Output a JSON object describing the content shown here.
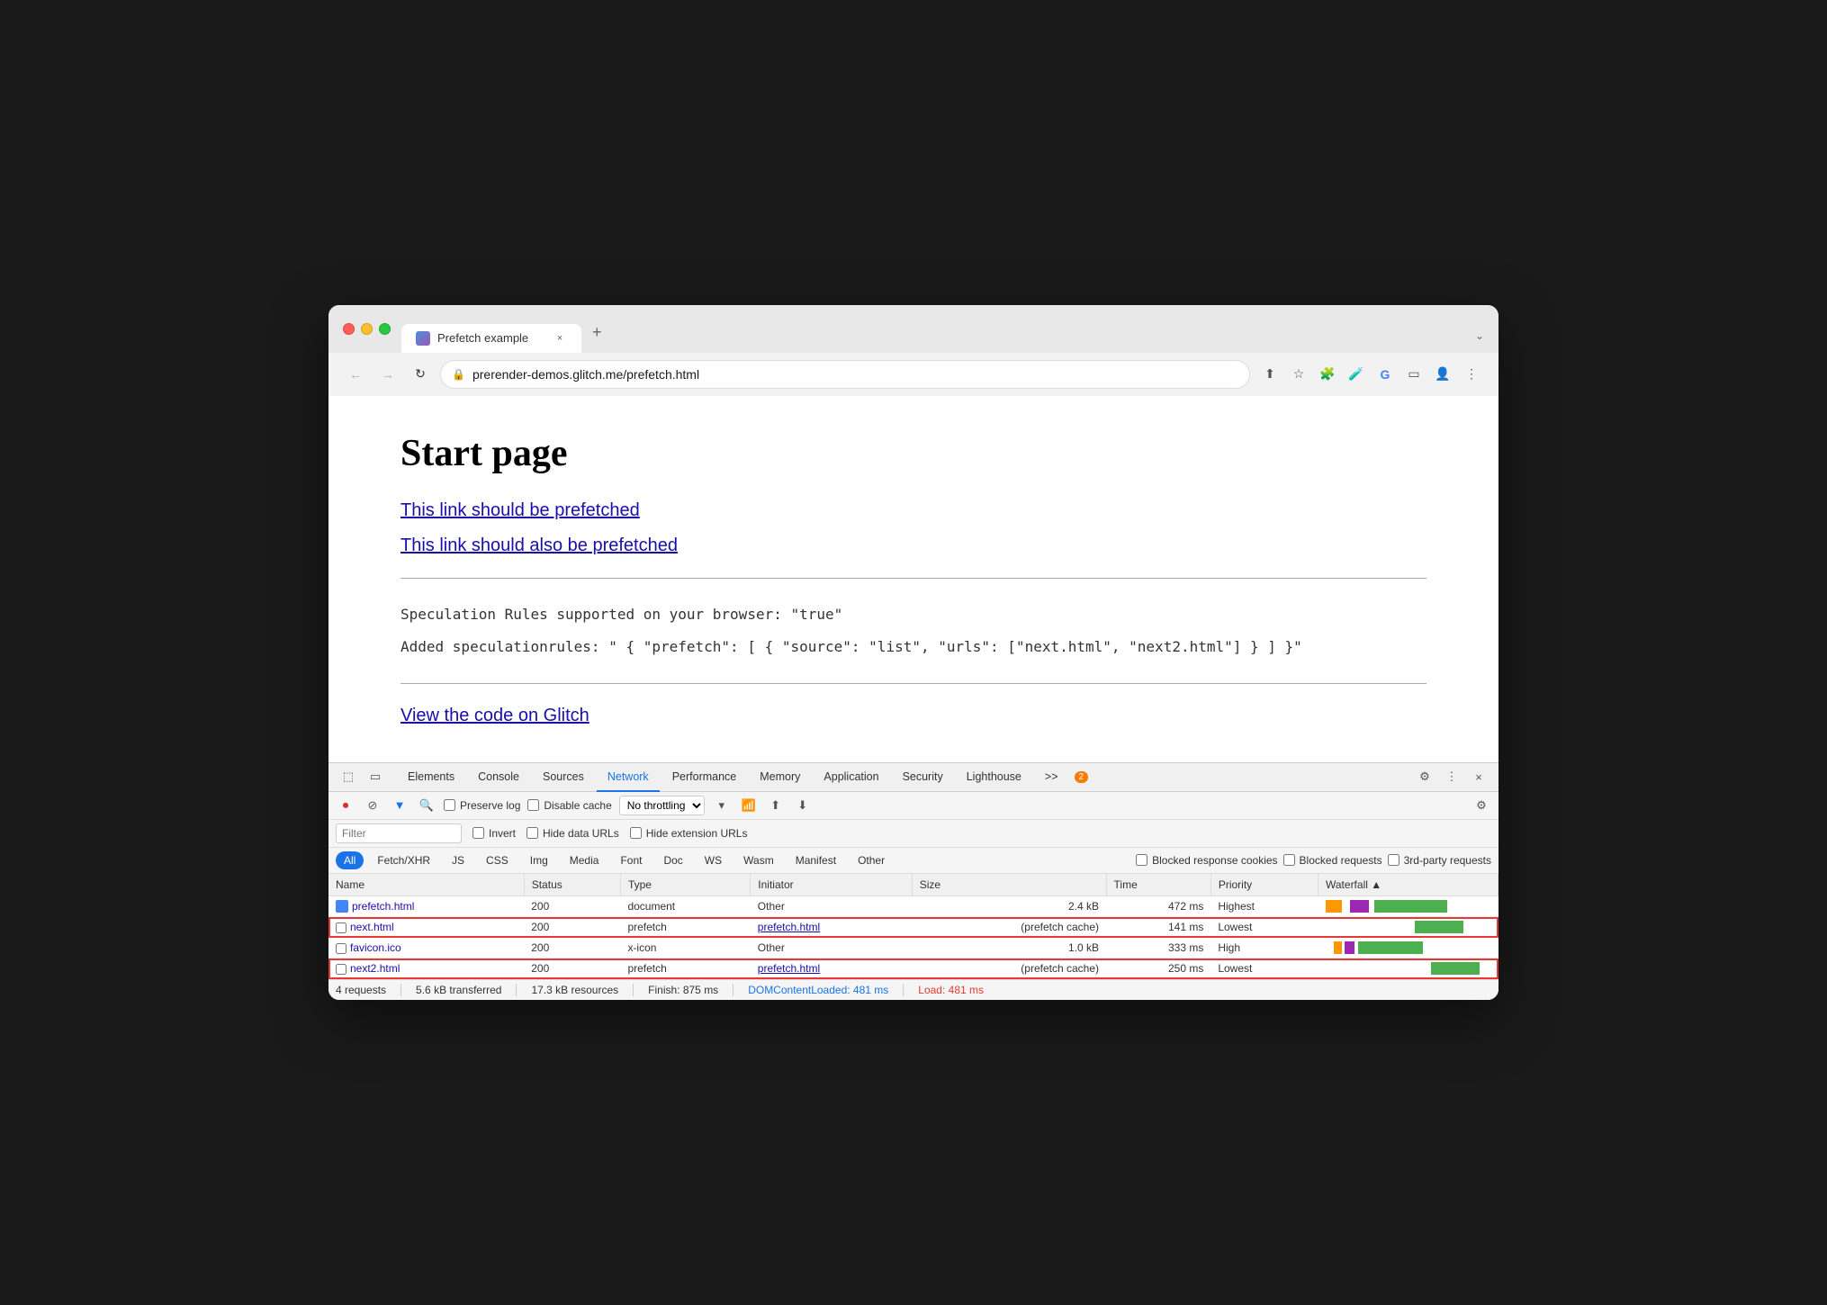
{
  "browser": {
    "tab_title": "Prefetch example",
    "tab_close": "×",
    "tab_new": "+",
    "tab_chevron": "⌄",
    "url": "prerender-demos.glitch.me/prefetch.html",
    "nav_back": "←",
    "nav_forward": "→",
    "nav_reload": "↻"
  },
  "page": {
    "title": "Start page",
    "link1": "This link should be prefetched",
    "link2": "This link should also be prefetched",
    "speculation1": "Speculation Rules supported on your browser: \"true\"",
    "speculation2": "Added speculationrules: \" { \"prefetch\": [ { \"source\": \"list\", \"urls\": [\"next.html\", \"next2.html\"] } ] }\"",
    "glitch_link": "View the code on Glitch"
  },
  "devtools": {
    "tabs": [
      "Elements",
      "Console",
      "Sources",
      "Network",
      "Performance",
      "Memory",
      "Application",
      "Security",
      "Lighthouse"
    ],
    "active_tab": "Network",
    "more_tabs": ">>",
    "badge_count": "2",
    "settings_icon": "⚙",
    "more_icon": "⋮",
    "close_icon": "×"
  },
  "network_toolbar": {
    "record": "●",
    "clear": "⊘",
    "filter": "▼",
    "search": "🔍",
    "preserve_log": "Preserve log",
    "disable_cache": "Disable cache",
    "throttle": "No throttling",
    "upload": "↑",
    "download": "↓",
    "settings": "⚙"
  },
  "filter_row": {
    "placeholder": "Filter",
    "invert": "Invert",
    "hide_data_urls": "Hide data URLs",
    "hide_extension_urls": "Hide extension URLs"
  },
  "type_filters": [
    "All",
    "Fetch/XHR",
    "JS",
    "CSS",
    "Img",
    "Media",
    "Font",
    "Doc",
    "WS",
    "Wasm",
    "Manifest",
    "Other"
  ],
  "blocked_filters": {
    "blocked_response_cookies": "Blocked response cookies",
    "blocked_requests": "Blocked requests",
    "third_party_requests": "3rd-party requests"
  },
  "table": {
    "headers": [
      "Name",
      "Status",
      "Type",
      "Initiator",
      "Size",
      "Time",
      "Priority",
      "Waterfall"
    ],
    "rows": [
      {
        "name": "prefetch.html",
        "status": "200",
        "type": "document",
        "initiator": "Other",
        "size": "2.4 kB",
        "time": "472 ms",
        "priority": "Highest",
        "has_icon": true,
        "highlighted": false,
        "waterfall_colors": [
          "#ff9800",
          "#9c27b0",
          "#4caf50"
        ],
        "waterfall_offsets": [
          0,
          15,
          30
        ],
        "waterfall_widths": [
          10,
          12,
          45
        ]
      },
      {
        "name": "next.html",
        "status": "200",
        "type": "prefetch",
        "initiator": "prefetch.html",
        "size": "(prefetch cache)",
        "time": "141 ms",
        "priority": "Lowest",
        "has_icon": false,
        "highlighted": true,
        "waterfall_colors": [
          "#4caf50"
        ],
        "waterfall_offsets": [
          55
        ],
        "waterfall_widths": [
          30
        ]
      },
      {
        "name": "favicon.ico",
        "status": "200",
        "type": "x-icon",
        "initiator": "Other",
        "size": "1.0 kB",
        "time": "333 ms",
        "priority": "High",
        "has_icon": false,
        "highlighted": false,
        "waterfall_colors": [
          "#ff9800",
          "#9c27b0",
          "#4caf50"
        ],
        "waterfall_offsets": [
          5,
          12,
          20
        ],
        "waterfall_widths": [
          5,
          6,
          40
        ]
      },
      {
        "name": "next2.html",
        "status": "200",
        "type": "prefetch",
        "initiator": "prefetch.html",
        "size": "(prefetch cache)",
        "time": "250 ms",
        "priority": "Lowest",
        "has_icon": false,
        "highlighted": true,
        "waterfall_colors": [
          "#4caf50"
        ],
        "waterfall_offsets": [
          65
        ],
        "waterfall_widths": [
          30
        ]
      }
    ]
  },
  "status_bar": {
    "requests": "4 requests",
    "transferred": "5.6 kB transferred",
    "resources": "17.3 kB resources",
    "finish": "Finish: 875 ms",
    "dom_content_loaded": "DOMContentLoaded: 481 ms",
    "load": "Load: 481 ms"
  }
}
